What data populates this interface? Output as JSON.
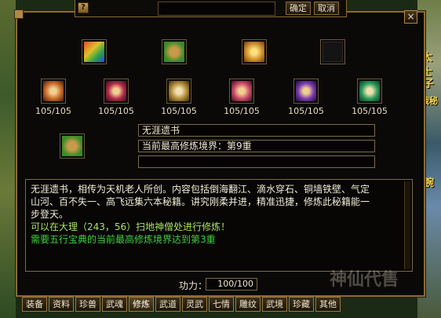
{
  "top_bar": {
    "confirm_label": "确定",
    "cancel_label": "取消",
    "help_label": "?"
  },
  "window": {
    "close_label": "×"
  },
  "side_labels": [
    "太士",
    "子",
    "战秘",
    "腕"
  ],
  "items_top": [
    {
      "name": "rainbow-book",
      "color": "#c84a2a"
    },
    {
      "name": "green-scroll-bundle",
      "color": "#3a8a2a"
    },
    {
      "name": "golden-chest",
      "color": "#c89a2a"
    },
    {
      "name": "empty-slot",
      "color": "#1a1a1a"
    }
  ],
  "items_middle": [
    {
      "count": "105/105",
      "color": "#c86a2a"
    },
    {
      "count": "105/105",
      "color": "#b02a4a"
    },
    {
      "count": "105/105",
      "color": "#b08a3a"
    },
    {
      "count": "105/105",
      "color": "#c84a6a"
    },
    {
      "count": "105/105",
      "color": "#7a3ab0"
    },
    {
      "count": "105/105",
      "color": "#2a9a5a"
    }
  ],
  "selected_item": {
    "color": "#3a8a2a"
  },
  "info": {
    "name": "无涯遗书",
    "level": "当前最高修炼境界：第9重",
    "extra": ""
  },
  "description": {
    "line1": "无涯遗书，相传为天机老人所创。内容包括倒海翻江、滴水穿石、铜墙铁壁、气定",
    "line2": "山河、百不失一、高飞远集六本秘籍。讲究刚柔并进，精准迅捷，修炼此秘籍能一",
    "line3": "步登天。",
    "location": "可以在大理（243，56）扫地神僧处进行修炼！",
    "requirement": "需要五行宝典的当前最高修炼境界达到第3重"
  },
  "power": {
    "label": "功力：",
    "value": "100/100"
  },
  "tabs": [
    "装备",
    "资料",
    "珍兽",
    "武魂",
    "修炼",
    "武道",
    "灵武",
    "七情",
    "雕纹",
    "武境",
    "珍藏",
    "其他"
  ],
  "active_tab": "修炼",
  "watermark": "神仙代售"
}
